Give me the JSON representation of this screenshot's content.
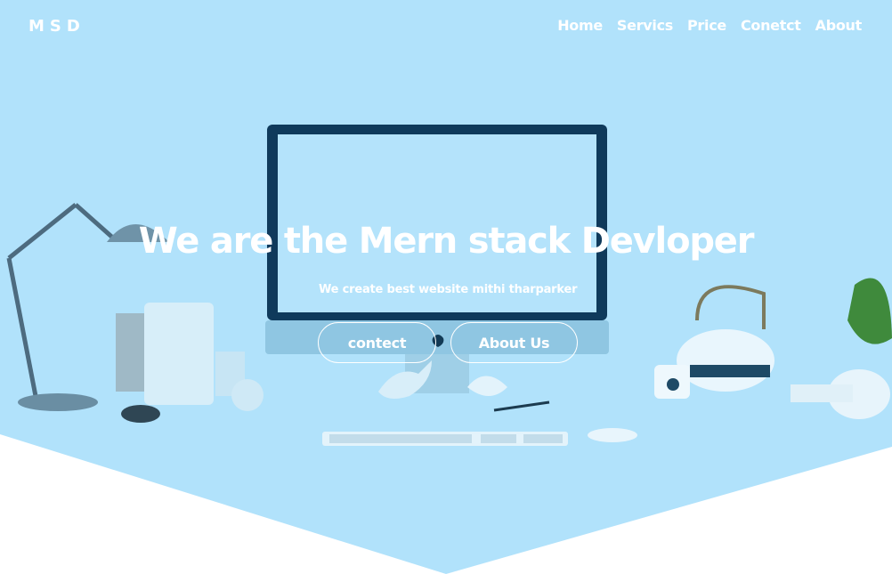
{
  "brand": "MSD",
  "nav": {
    "items": [
      "Home",
      "Servics",
      "Price",
      "Conetct",
      "About"
    ]
  },
  "hero": {
    "title": "We are the Mern stack Devloper",
    "subtitle": "We create best website mithi tharparker",
    "buttons": {
      "contact": "contect",
      "about": "About Us"
    }
  },
  "colors": {
    "hero_bg": "#b1e2fb",
    "text": "#ffffff",
    "monitor_frame": "#0f3a5b"
  }
}
